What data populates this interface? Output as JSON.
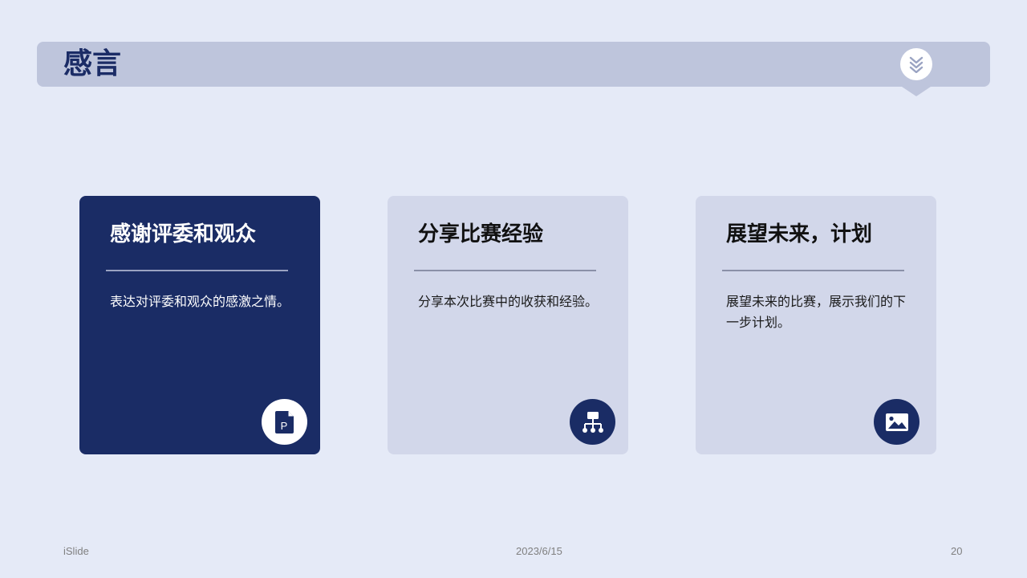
{
  "slide": {
    "title": "感言",
    "cards": [
      {
        "title": "感谢评委和观众",
        "description": "表达对评委和观众的感激之情。",
        "icon": "ppt-file-icon",
        "theme": "dark"
      },
      {
        "title": "分享比赛经验",
        "description": "分享本次比赛中的收获和经验。",
        "icon": "org-chart-icon",
        "theme": "light"
      },
      {
        "title": "展望未来，计划",
        "description": "展望未来的比赛，展示我们的下一步计划。",
        "icon": "image-icon",
        "theme": "light"
      }
    ]
  },
  "footer": {
    "brand": "iSlide",
    "date": "2023/6/15",
    "page_number": "20"
  },
  "colors": {
    "background": "#E5EAF7",
    "title_bar": "#BEC5DC",
    "navy": "#1A2C65",
    "card_light": "#D2D7EA"
  }
}
